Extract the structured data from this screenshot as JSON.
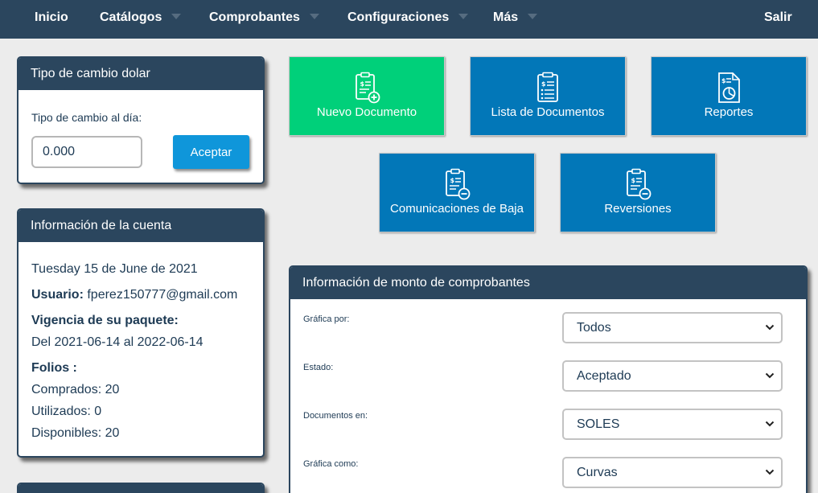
{
  "nav": {
    "inicio": "Inicio",
    "catalogos": "Catálogos",
    "comprobantes": "Comprobantes",
    "configuraciones": "Configuraciones",
    "mas": "Más",
    "salir": "Salir"
  },
  "exchange": {
    "title": "Tipo de cambio dolar",
    "label": "Tipo de cambio al día:",
    "value": "0.000",
    "button": "Aceptar"
  },
  "account": {
    "title": "Información de la cuenta",
    "date": "Tuesday 15 de June de 2021",
    "user_label": "Usuario:",
    "user_email": "fperez150777@gmail.com",
    "validity_label": "Vigencia de su paquete:",
    "validity_range": "Del 2021-06-14 al 2022-06-14",
    "folios_label": "Folios :",
    "purchased": "Comprados: 20",
    "used": "Utilizados: 0",
    "available": "Disponibles: 20"
  },
  "tiles": {
    "nuevo": "Nuevo Documento",
    "lista": "Lista de Documentos",
    "reportes": "Reportes",
    "bajas": "Comunicaciones de Baja",
    "reversiones": "Reversiones"
  },
  "colors": {
    "navbar": "#2b465e",
    "tile_blue": "#0277b8",
    "tile_green": "#00d07a",
    "accept_button": "#0f96da"
  },
  "amounts": {
    "title": "Información de monto de comprobantes",
    "fields": [
      {
        "label": "Gráfica por:",
        "value": "Todos"
      },
      {
        "label": "Estado:",
        "value": "Aceptado"
      },
      {
        "label": "Documentos en:",
        "value": "SOLES"
      },
      {
        "label": "Gráfica como:",
        "value": "Curvas"
      }
    ]
  }
}
